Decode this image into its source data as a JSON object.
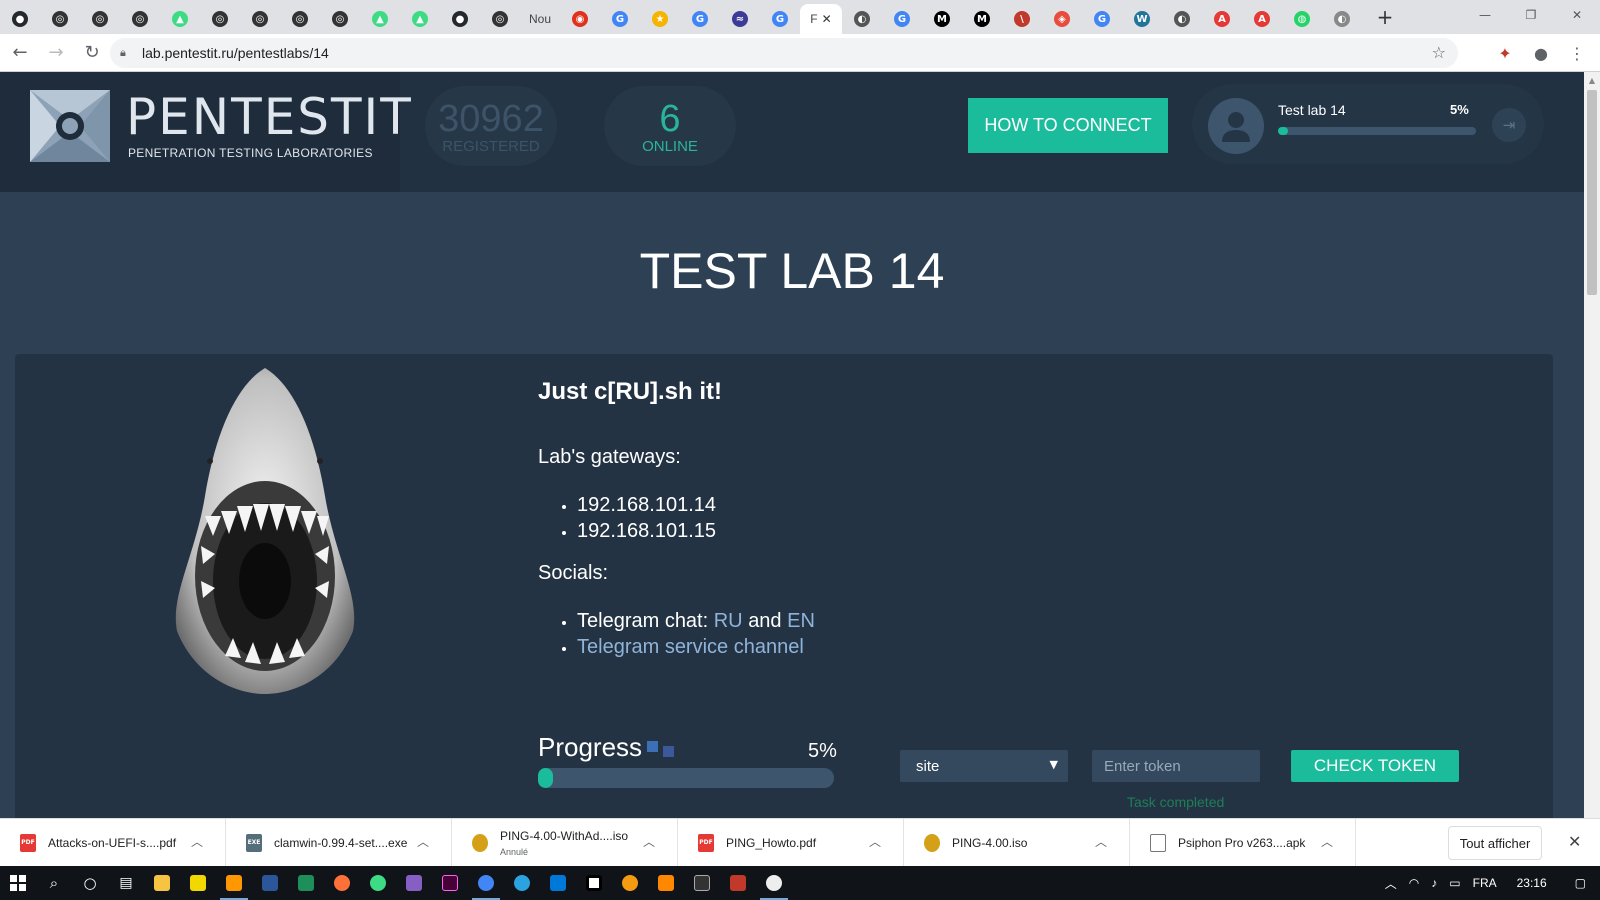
{
  "browser": {
    "tabs": [
      {
        "icon": "github-icon",
        "color": "#24292e",
        "glyph": "●"
      },
      {
        "icon": "circle-icon",
        "color": "#333",
        "glyph": "◎"
      },
      {
        "icon": "circle-icon",
        "color": "#333",
        "glyph": "◎"
      },
      {
        "icon": "circle-icon",
        "color": "#333",
        "glyph": "◎"
      },
      {
        "icon": "android-icon",
        "color": "#3ddc84",
        "glyph": "▲"
      },
      {
        "icon": "circle-icon",
        "color": "#333",
        "glyph": "◎"
      },
      {
        "icon": "circle-icon",
        "color": "#333",
        "glyph": "◎"
      },
      {
        "icon": "circle-icon",
        "color": "#333",
        "glyph": "◎"
      },
      {
        "icon": "circle-icon",
        "color": "#333",
        "glyph": "◎"
      },
      {
        "icon": "android-icon",
        "color": "#3ddc84",
        "glyph": "▲"
      },
      {
        "icon": "android-icon",
        "color": "#3ddc84",
        "glyph": "▲"
      },
      {
        "icon": "github-icon",
        "color": "#24292e",
        "glyph": "●"
      },
      {
        "icon": "circle-icon",
        "color": "#333",
        "glyph": "◎"
      },
      {
        "icon": "text-tab",
        "text": "Nou"
      },
      {
        "icon": "opera-icon",
        "color": "#e0301e",
        "glyph": "◉"
      },
      {
        "icon": "google-icon",
        "color": "#4285f4",
        "glyph": "G"
      },
      {
        "icon": "star-icon",
        "color": "#f4b400",
        "glyph": "★"
      },
      {
        "icon": "google-icon",
        "color": "#4285f4",
        "glyph": "G"
      },
      {
        "icon": "analytics-icon",
        "color": "#3b3b98",
        "glyph": "≈"
      },
      {
        "icon": "google-icon",
        "color": "#4285f4",
        "glyph": "G"
      },
      {
        "icon": "active-tab",
        "text": "F"
      },
      {
        "icon": "globe-icon",
        "color": "#555",
        "glyph": "◐"
      },
      {
        "icon": "google-icon",
        "color": "#4285f4",
        "glyph": "G"
      },
      {
        "icon": "medium-icon",
        "color": "#000",
        "glyph": "M"
      },
      {
        "icon": "medium-icon",
        "color": "#000",
        "glyph": "M"
      },
      {
        "icon": "slash-icon",
        "color": "#c0392b",
        "glyph": "\\"
      },
      {
        "icon": "shield-icon",
        "color": "#e74c3c",
        "glyph": "◈"
      },
      {
        "icon": "google-icon",
        "color": "#4285f4",
        "glyph": "G"
      },
      {
        "icon": "wordpress-icon",
        "color": "#21759b",
        "glyph": "W"
      },
      {
        "icon": "globe-icon",
        "color": "#555",
        "glyph": "◐"
      },
      {
        "icon": "pdf-icon",
        "color": "#e53935",
        "glyph": "A"
      },
      {
        "icon": "pdf-icon",
        "color": "#e53935",
        "glyph": "A"
      },
      {
        "icon": "whatsapp-icon",
        "color": "#25d366",
        "glyph": "◍"
      },
      {
        "icon": "globe-icon",
        "color": "#888",
        "glyph": "◐"
      }
    ],
    "url": "lab.pentestit.ru/pentestlabs/14"
  },
  "header": {
    "logo_title": "PENTESTIT",
    "logo_subtitle": "PENETRATION TESTING LABORATORIES",
    "registered_count": "30962",
    "registered_label": "REGISTERED",
    "online_count": "6",
    "online_label": "ONLINE",
    "how_to_connect": "HOW TO CONNECT",
    "user_lab": "Test lab 14",
    "user_progress_label": "5%",
    "user_progress": 0.05
  },
  "main": {
    "title": "TEST LAB 14",
    "slogan": "Just c[RU].sh it!",
    "gateways_heading": "Lab's gateways:",
    "gateways": [
      "192.168.101.14",
      "192.168.101.15"
    ],
    "socials_heading": "Socials:",
    "telegram_chat_prefix": "Telegram chat:",
    "telegram_ru": "RU",
    "and_word": "and",
    "telegram_en": "EN",
    "telegram_channel": "Telegram service channel",
    "progress_label": "Progress",
    "progress_pct_label": "5%",
    "progress": 0.05,
    "select_value": "site",
    "token_placeholder": "Enter token",
    "check_token": "CHECK TOKEN",
    "task_status": "Task completed"
  },
  "downloads": {
    "items": [
      {
        "icon": "pdf-file-icon",
        "name": "Attacks-on-UEFI-s....pdf",
        "status": ""
      },
      {
        "icon": "installer-icon",
        "name": "clamwin-0.99.4-set....exe",
        "status": ""
      },
      {
        "icon": "disc-image-icon",
        "name": "PING-4.00-WithAd....iso",
        "status": "Annulé"
      },
      {
        "icon": "pdf-file-icon",
        "name": "PING_Howto.pdf",
        "status": ""
      },
      {
        "icon": "disc-image-icon",
        "name": "PING-4.00.iso",
        "status": ""
      },
      {
        "icon": "file-icon",
        "name": "Psiphon Pro v263....apk",
        "status": ""
      }
    ],
    "show_all": "Tout afficher"
  },
  "taskbar": {
    "language": "FRA",
    "time": "23:16"
  }
}
